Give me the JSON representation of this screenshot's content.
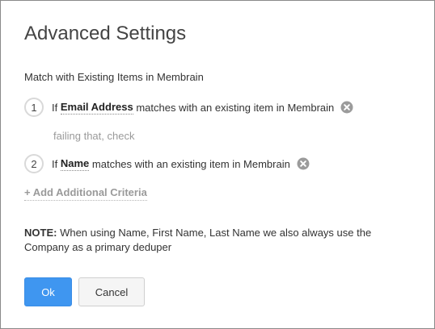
{
  "dialog": {
    "title": "Advanced Settings",
    "section_label": "Match with Existing Items in Membrain",
    "criteria": [
      {
        "step": "1",
        "prefix": "If",
        "field": "Email Address",
        "suffix": "matches with an existing item in Membrain",
        "remove_icon": "remove-circle-icon"
      },
      {
        "step": "2",
        "prefix": "If",
        "field": "Name",
        "suffix": "matches with an existing item in Membrain",
        "remove_icon": "remove-circle-icon"
      }
    ],
    "fallback_text": "failing that, check",
    "add_criteria_label": "+ Add Additional Criteria",
    "note_label": "NOTE:",
    "note_text": "When using Name, First Name, Last Name we also always use the Company as a primary deduper",
    "buttons": {
      "ok_label": "Ok",
      "cancel_label": "Cancel"
    }
  },
  "colors": {
    "primary_button": "#3f96f0",
    "muted_text": "#9a9a9a",
    "remove_icon": "#9b9b9b"
  }
}
